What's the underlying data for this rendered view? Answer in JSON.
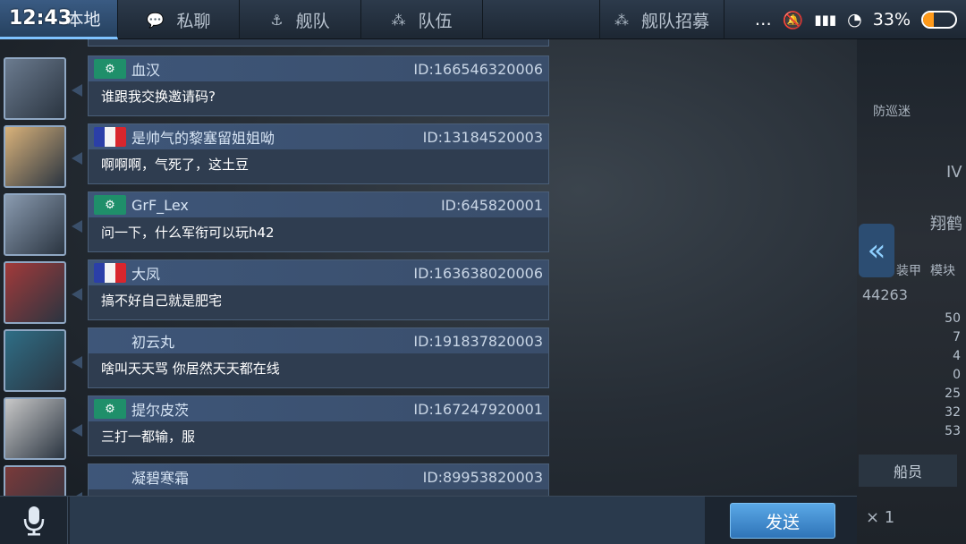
{
  "status_bar": {
    "time": "12:43",
    "battery_text": "33%",
    "battery_level": 0.33,
    "icons": [
      "more-icon",
      "mute-icon",
      "signal-icon",
      "wifi-icon"
    ]
  },
  "tabs": [
    {
      "label": "本地",
      "icon": "location-icon",
      "active": true
    },
    {
      "label": "私聊",
      "icon": "chat-bubble-icon",
      "active": false
    },
    {
      "label": "舰队",
      "icon": "fleet-icon",
      "active": false
    },
    {
      "label": "队伍",
      "icon": "team-icon",
      "active": false
    },
    {
      "label": "舰队招募",
      "icon": "recruit-icon",
      "active": false
    }
  ],
  "messages": [
    {
      "name": "血汉",
      "uid": "ID:166546320006",
      "text": "谁跟我交换邀请码?",
      "flag": "green",
      "avatar_color": "#6b7b8f"
    },
    {
      "name": "是帅气的黎塞留姐姐呦",
      "uid": "ID:13184520003",
      "text": "啊啊啊，气死了，这土豆",
      "flag": "france",
      "avatar_color": "#d9b27a"
    },
    {
      "name": "GrF_Lex",
      "uid": "ID:645820001",
      "text": "问一下，什么军衔可以玩h42",
      "flag": "green",
      "avatar_color": "#8a9bb0"
    },
    {
      "name": "大凤",
      "uid": "ID:163638020006",
      "text": "搞不好自己就是肥宅",
      "flag": "france",
      "avatar_color": "#a23a3a"
    },
    {
      "name": "初云丸",
      "uid": "ID:191837820003",
      "text": "啥叫天天骂 你居然天天都在线",
      "flag": "none",
      "avatar_color": "#2f6e86"
    },
    {
      "name": "提尔皮茨",
      "uid": "ID:167247920001",
      "text": "三打一都输，服",
      "flag": "green",
      "avatar_color": "#c8c8c8"
    },
    {
      "name": "凝碧寒霜",
      "uid": "ID:89953820003",
      "text": "",
      "flag": "none",
      "avatar_color": "#7a3a3a"
    }
  ],
  "side_panel": {
    "arrow": "«",
    "tag": "IV",
    "ship": "翔鹤",
    "label_a": "防巡迷",
    "label_b": "装甲",
    "label_c": "模块",
    "power": "44263",
    "stats": [
      "50",
      "7",
      "4",
      "0",
      "25",
      "32",
      "53"
    ],
    "crew_label": "船员",
    "count": "× 1"
  },
  "input": {
    "placeholder": "",
    "send_label": "发送"
  }
}
